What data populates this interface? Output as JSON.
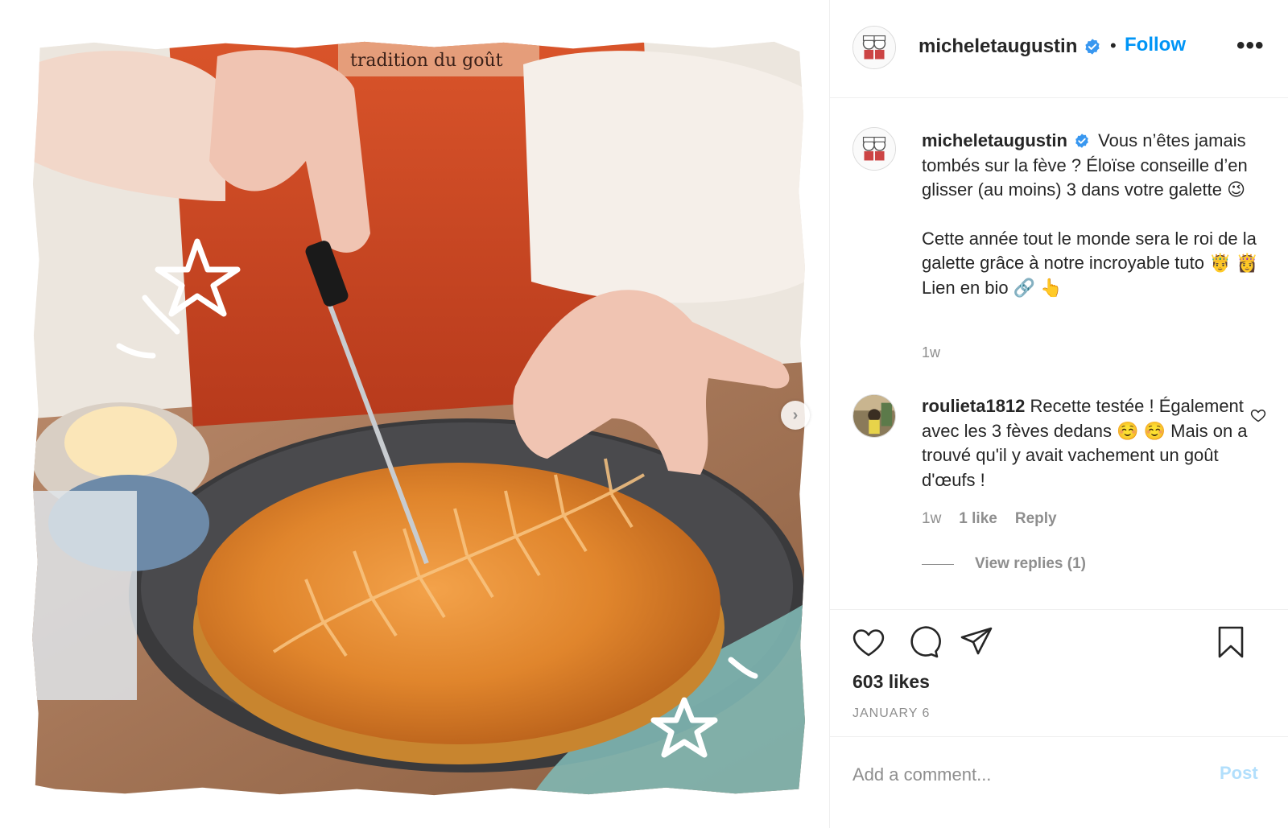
{
  "post": {
    "image_alt": "Galette des rois being cut with a knife",
    "apron_text": "tradition du goût"
  },
  "header": {
    "username": "micheletaugustin",
    "separator": "•",
    "follow_label": "Follow",
    "more_label": "•••"
  },
  "caption": {
    "username": "micheletaugustin",
    "paragraph1": "Vous n’êtes jamais tombés sur la fève ? Éloïse conseille d’en glisser (au moins) 3 dans votre galette 😉",
    "paragraph2": "Cette année tout le monde sera le roi de la galette grâce à notre incroyable tuto 🤴 👸 Lien en bio 🔗 👆",
    "time": "1w"
  },
  "comments": [
    {
      "username": "roulieta1812",
      "text": "Recette testée ! Également avec les 3 fèves dedans ☺️ ☺️ Mais on a trouvé qu'il y avait vachement un goût d'œufs !",
      "time": "1w",
      "likes": "1 like",
      "reply_label": "Reply",
      "view_replies": "View replies (1)"
    }
  ],
  "actions": {
    "likes": "603 likes",
    "date": "JANUARY 6"
  },
  "add_comment": {
    "placeholder": "Add a comment...",
    "post_label": "Post"
  },
  "colors": {
    "accent": "#0095f6",
    "verified": "#3897f0",
    "muted": "#8e8e8e",
    "post_disabled": "#b2dffc"
  }
}
